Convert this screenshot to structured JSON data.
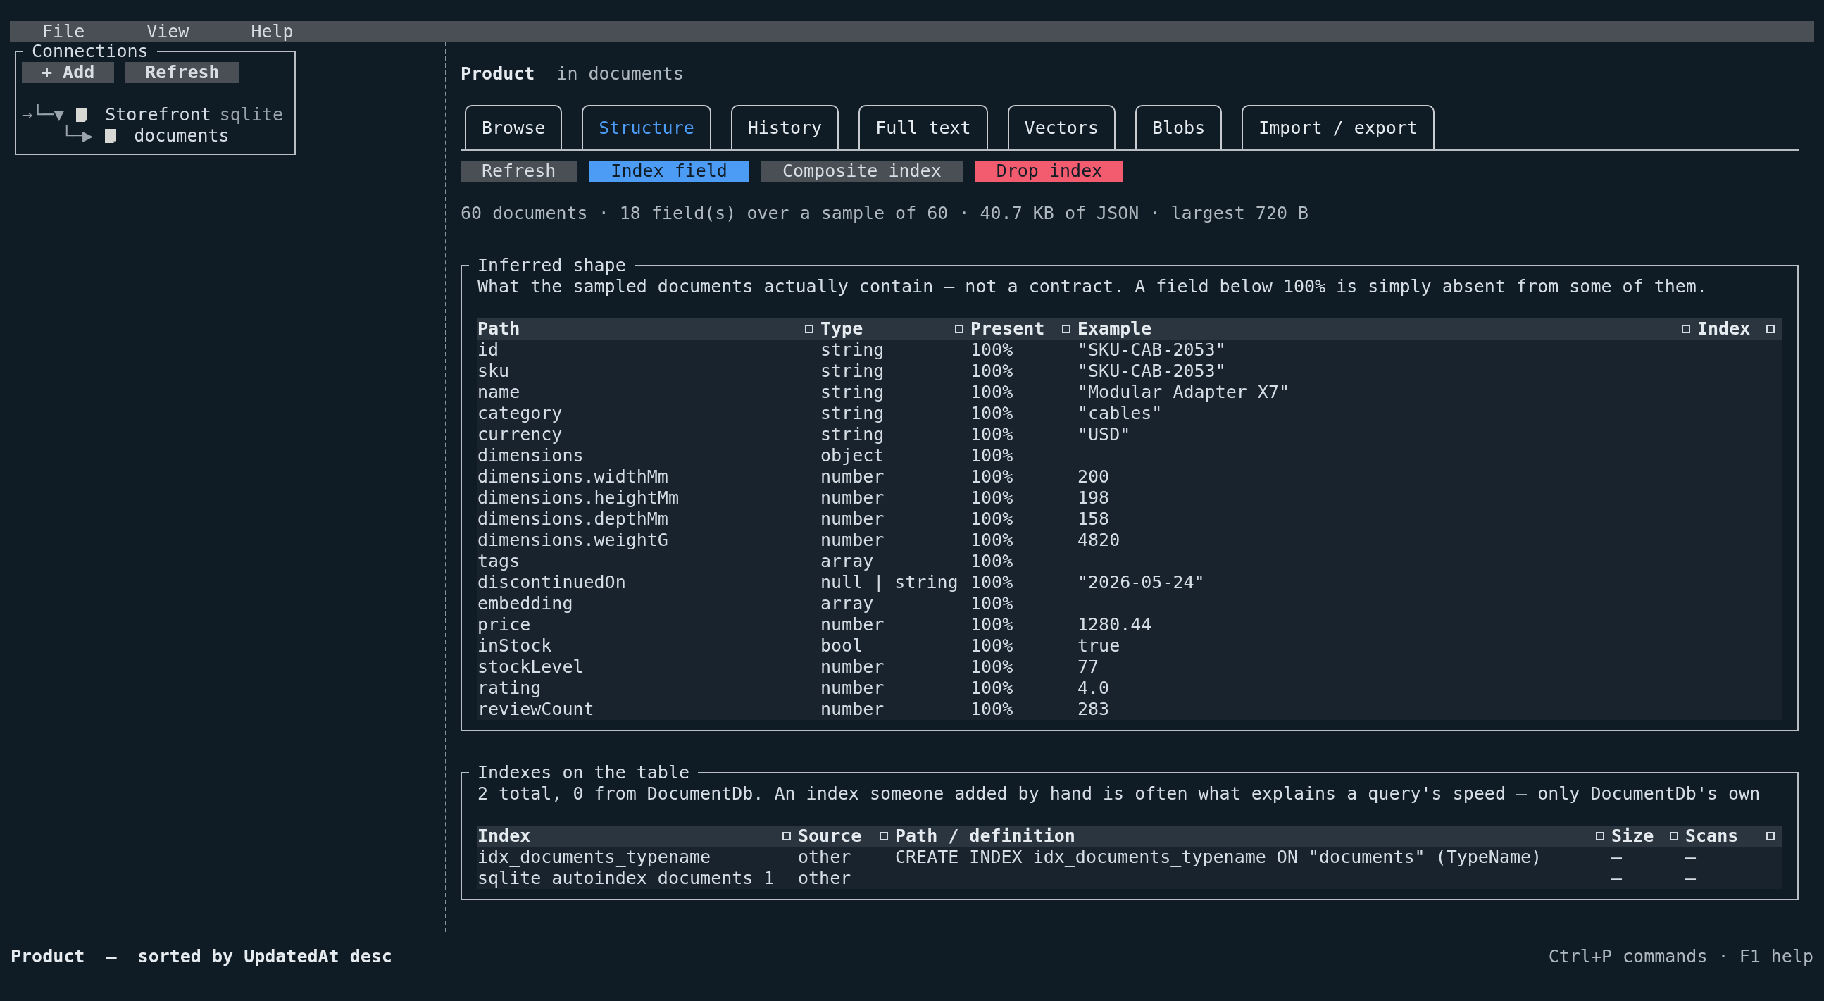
{
  "menu": [
    "File",
    "View",
    "Help"
  ],
  "connections": {
    "title": "Connections",
    "buttons": [
      "+ Add",
      "Refresh"
    ],
    "tree": [
      {
        "prefix": "→└─▼",
        "label": "Storefront",
        "note": "sqlite",
        "children": [
          {
            "prefix": "└─▶",
            "label": "documents"
          }
        ]
      }
    ]
  },
  "heading": {
    "title": "Product",
    "subtitle": "in documents"
  },
  "tabs": [
    {
      "label": "Browse",
      "selected": false
    },
    {
      "label": "Structure",
      "selected": true
    },
    {
      "label": "History",
      "selected": false
    },
    {
      "label": "Full text",
      "selected": false
    },
    {
      "label": "Vectors",
      "selected": false
    },
    {
      "label": "Blobs",
      "selected": false
    },
    {
      "label": "Import / export",
      "selected": false
    }
  ],
  "actions": [
    {
      "label": "Refresh",
      "kind": "default"
    },
    {
      "label": "Index field",
      "kind": "primary"
    },
    {
      "label": "Composite index",
      "kind": "default"
    },
    {
      "label": "Drop index",
      "kind": "danger"
    }
  ],
  "summary": "60 documents · 18 field(s) over a sample of 60 · 40.7 KB of JSON · largest 720 B",
  "inferred_shape": {
    "title": "Inferred shape",
    "description": "What the sampled documents actually contain — not a contract. A field below 100% is simply absent from some of them.",
    "columns": [
      "Path",
      "Type",
      "Present",
      "Example",
      "Index"
    ],
    "rows": [
      [
        "id",
        "string",
        "100%",
        "\"SKU-CAB-2053\""
      ],
      [
        "sku",
        "string",
        "100%",
        "\"SKU-CAB-2053\""
      ],
      [
        "name",
        "string",
        "100%",
        "\"Modular Adapter X7\""
      ],
      [
        "category",
        "string",
        "100%",
        "\"cables\""
      ],
      [
        "currency",
        "string",
        "100%",
        "\"USD\""
      ],
      [
        "dimensions",
        "object",
        "100%"
      ],
      [
        "dimensions.widthMm",
        "number",
        "100%",
        "200"
      ],
      [
        "dimensions.heightMm",
        "number",
        "100%",
        "198"
      ],
      [
        "dimensions.depthMm",
        "number",
        "100%",
        "158"
      ],
      [
        "dimensions.weightG",
        "number",
        "100%",
        "4820"
      ],
      [
        "tags",
        "array",
        "100%"
      ],
      [
        "discontinuedOn",
        "null | string",
        "100%",
        "\"2026-05-24\""
      ],
      [
        "embedding",
        "array",
        "100%"
      ],
      [
        "price",
        "number",
        "100%",
        "1280.44"
      ],
      [
        "inStock",
        "bool",
        "100%",
        "true"
      ],
      [
        "stockLevel",
        "number",
        "100%",
        "77"
      ],
      [
        "rating",
        "number",
        "100%",
        "4.0"
      ],
      [
        "reviewCount",
        "number",
        "100%",
        "283"
      ]
    ]
  },
  "indexes": {
    "title": "Indexes on the table",
    "description": "2 total, 0 from DocumentDb. An index someone added by hand is often what explains a query's speed — only DocumentDb's own",
    "columns": [
      "Index",
      "Source",
      "Path / definition",
      "Size",
      "Scans"
    ],
    "rows": [
      [
        "idx_documents_typename",
        "other",
        "CREATE INDEX idx_documents_typename ON \"documents\" (TypeName)",
        "—",
        "—"
      ],
      [
        "sqlite_autoindex_documents_1",
        "other",
        "",
        "—",
        "—"
      ]
    ]
  },
  "status_bar": {
    "left": "Product  —  sorted by UpdatedAt desc",
    "right": "Ctrl+P commands · F1 help"
  }
}
